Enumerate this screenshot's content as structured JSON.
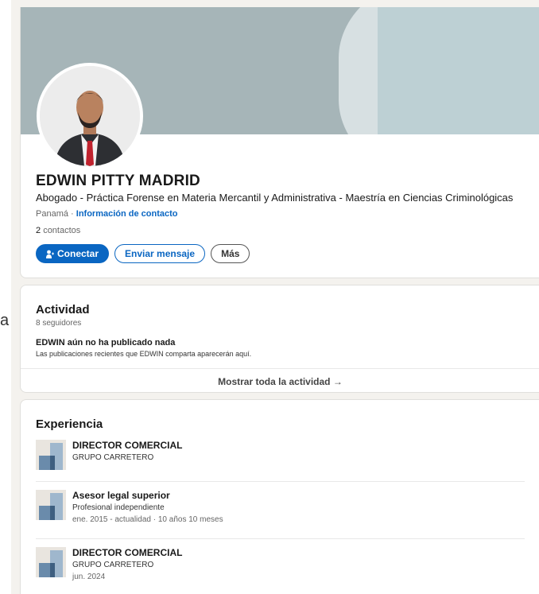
{
  "left_stray_char": "a",
  "profile": {
    "name": "EDWIN PITTY MADRID",
    "headline": "Abogado - Práctica Forense en Materia Mercantil y Administrativa - Maestría en Ciencias Criminológicas",
    "location": "Panamá",
    "location_sep": " · ",
    "contact_info_link": "Información de contacto",
    "connections_count": "2",
    "connections_label": "contactos",
    "buttons": {
      "connect": "Conectar",
      "message": "Enviar mensaje",
      "more": "Más"
    },
    "colors": {
      "accent": "#0a66c2",
      "banner": "#a6b5b8"
    }
  },
  "activity": {
    "title": "Actividad",
    "followers": "8 seguidores",
    "empty_title": "EDWIN aún no ha publicado nada",
    "empty_desc": "Las publicaciones recientes que EDWIN comparta aparecerán aquí.",
    "show_all": "Mostrar toda la actividad",
    "show_all_arrow": "→"
  },
  "experience": {
    "title": "Experiencia",
    "items": [
      {
        "title": "DIRECTOR COMERCIAL",
        "company": "GRUPO CARRETERO",
        "dates": ""
      },
      {
        "title": "Asesor legal superior",
        "company": "Profesional independiente",
        "dates": "ene. 2015 - actualidad · 10 años 10 meses"
      },
      {
        "title": "DIRECTOR COMERCIAL",
        "company": "GRUPO CARRETERO",
        "dates": "jun. 2024"
      }
    ]
  }
}
